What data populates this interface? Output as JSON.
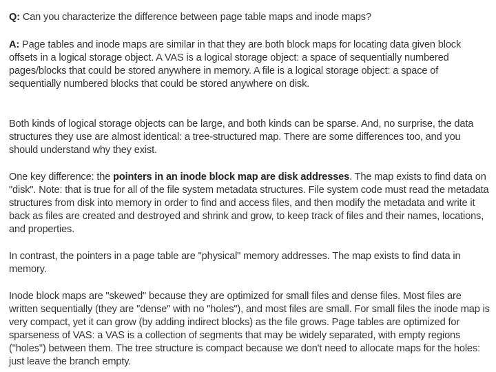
{
  "question": {
    "label": "Q:",
    "text": " Can you characterize the difference between page table maps and inode maps?"
  },
  "answer": {
    "label": "A:",
    "paragraphs": [
      {
        "text": " Page tables and inode maps are similar in that they are both block maps for locating data given block offsets in a logical storage object.  A VAS is a logical storage object: a space of sequentially numbered pages/blocks that could be stored anywhere in memory.   A file is a logical storage object: a space of sequentially numbered blocks that could be stored anywhere on disk."
      },
      {
        "text": "Both kinds of logical storage objects can be large, and both kinds can be sparse.  And, no surprise, the data structures they use are almost identical: a tree-structured map.  There are some differences too, and you should understand why they exist."
      },
      {
        "before": "One key difference: the ",
        "bold": "pointers in an inode block map are disk addresses",
        "after": ".  The map exists to find data on \"disk\".  Note: that is true for all of the file system metadata structures.   File system code must read the metadata structures from disk into memory in order to find and access files, and then modify the metadata and write it back as files are created and destroyed and shrink and grow, to keep track of files and their names, locations, and properties."
      },
      {
        "text": "In contrast, the pointers in a page table are \"physical\" memory addresses.  The map exists to find data in memory."
      },
      {
        "text": "Inode block maps are \"skewed\" because they are optimized for small files and dense files.  Most files are written sequentially (they are \"dense\" with no \"holes\"), and most files are small.  For small files the inode map is very compact, yet it can grow (by adding indirect blocks) as the file grows.  Page tables are optimized for sparseness of VAS: a VAS is a collection of segments that may be widely separated, with empty regions (\"holes\") between them.  The tree structure is compact because we don't need to allocate maps for the holes: just leave the branch empty."
      }
    ]
  }
}
